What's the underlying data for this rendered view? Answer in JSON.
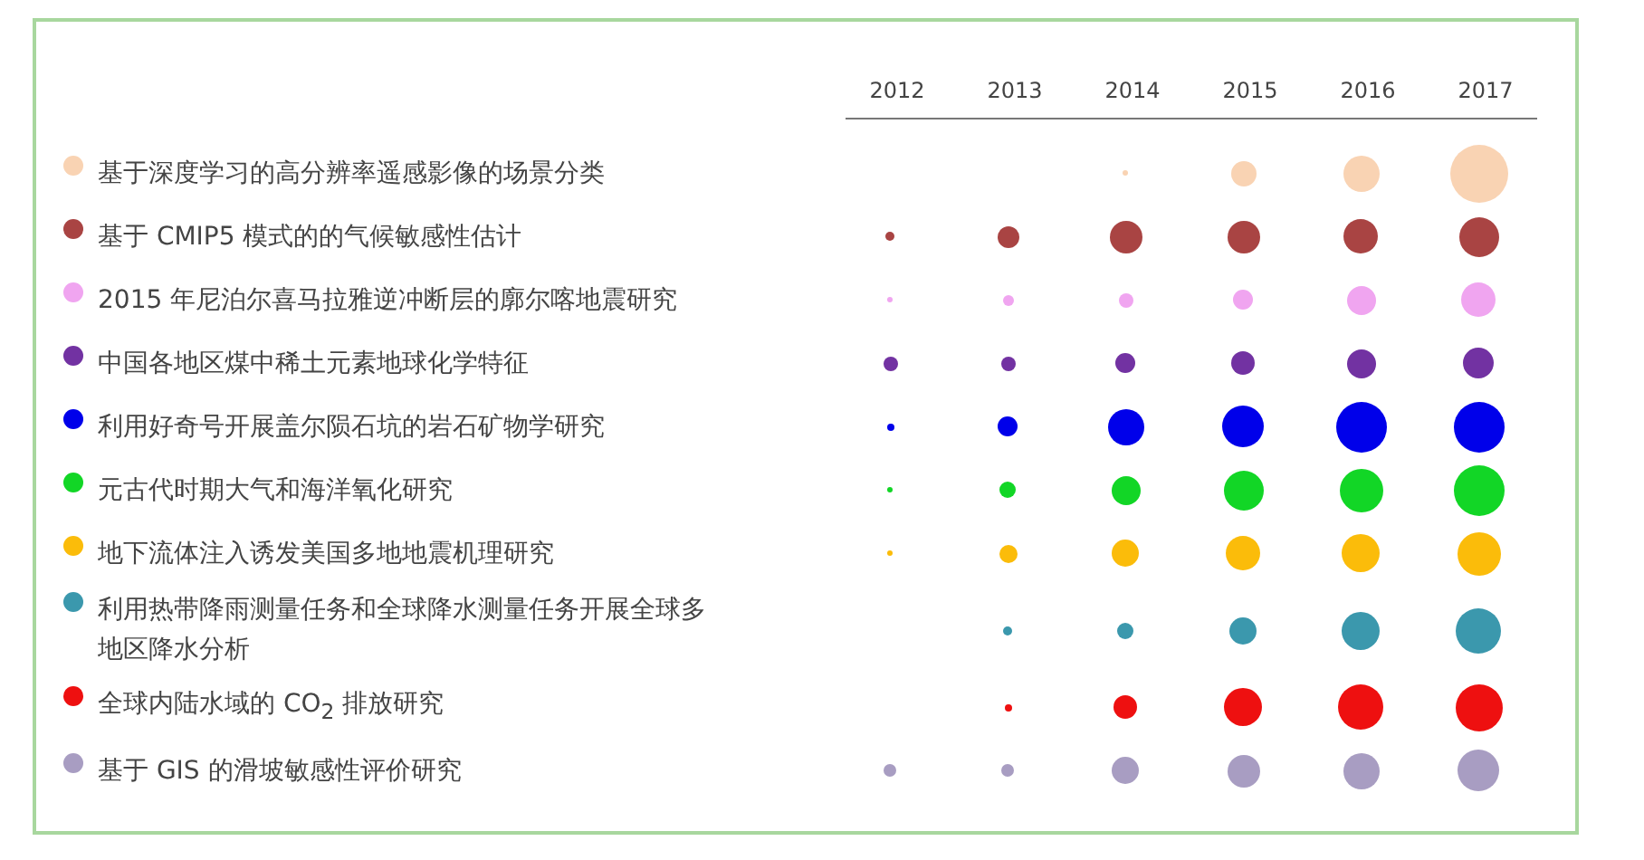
{
  "years": [
    "2012",
    "2013",
    "2014",
    "2015",
    "2016",
    "2017"
  ],
  "rows": [
    {
      "label": "基于深度学习的高分辨率遥感影像的场景分类",
      "color": "#f9d3b3"
    },
    {
      "label": "基于 CMIP5 模式的的气候敏感性估计",
      "color": "#a94443"
    },
    {
      "label": "2015 年尼泊尔喜马拉雅逆冲断层的廓尔喀地震研究",
      "color": "#f0a5f0"
    },
    {
      "label": "中国各地区煤中稀土元素地球化学特征",
      "color": "#7232a2"
    },
    {
      "label": "利用好奇号开展盖尔陨石坑的岩石矿物学研究",
      "color": "#0000ea"
    },
    {
      "label": "元古代时期大气和海洋氧化研究",
      "color": "#12d626"
    },
    {
      "label": "地下流体注入诱发美国多地地震机理研究",
      "color": "#fbbc0a"
    },
    {
      "label": "利用热带降雨测量任务和全球降水测量任务开展全球多地区降水分析",
      "color": "#3b98ad"
    },
    {
      "label": "全球内陆水域的 CO$_{2}$ 排放研究",
      "color": "#ee1010"
    },
    {
      "label": "基于 GIS 的滑坡敏感性评价研究",
      "color": "#a89dc2"
    }
  ]
}
